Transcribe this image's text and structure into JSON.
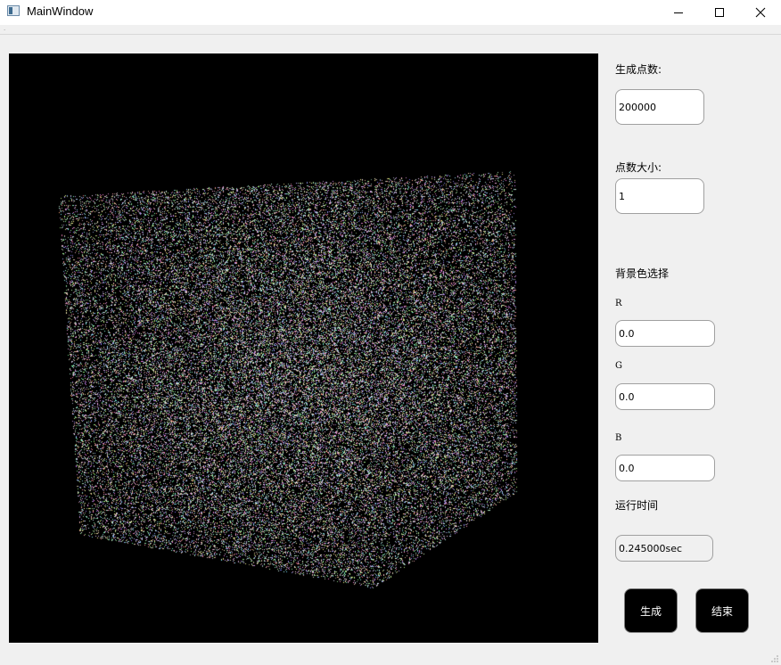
{
  "window": {
    "title": "MainWindow",
    "app_icon": "app-window-icon",
    "controls": [
      "minimize-icon",
      "maximize-icon",
      "close-icon"
    ]
  },
  "viewport": {
    "background": "#000000",
    "point_count": 200000,
    "point_size": 1
  },
  "panel": {
    "point_count_label": "生成点数:",
    "point_count_value": "200000",
    "point_size_label": "点数大小:",
    "point_size_value": "1",
    "bg_color_label": "背景色选择",
    "r_label": "R",
    "r_value": "0.0",
    "g_label": "G",
    "g_value": "0.0",
    "b_label": "B",
    "b_value": "0.0",
    "runtime_label": "运行时间",
    "runtime_value": "0.245000sec",
    "generate_button": "生成",
    "end_button": "结束"
  },
  "colors": {
    "window_bg": "#f0f0f0",
    "button_bg": "#000000",
    "button_text": "#ffffff"
  }
}
